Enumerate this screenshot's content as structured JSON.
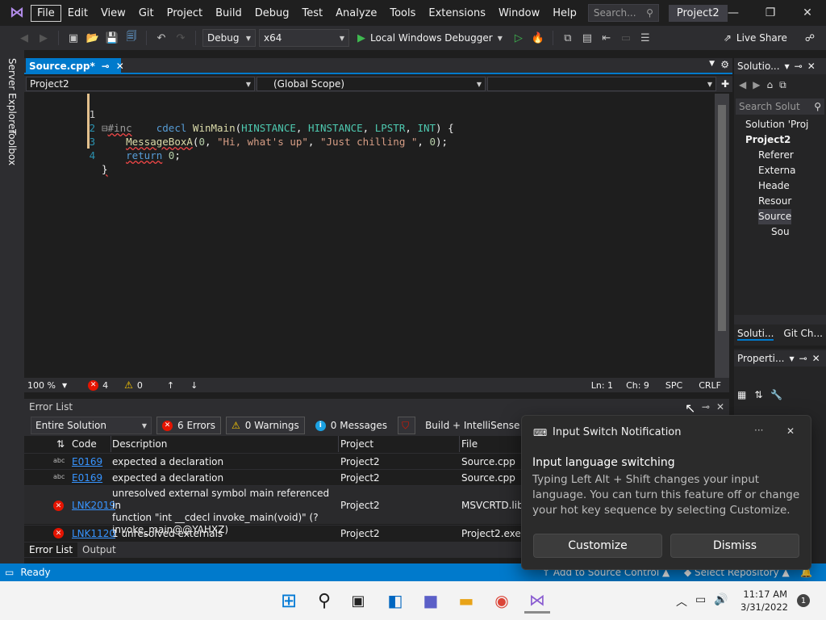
{
  "menubar": {
    "items": [
      "File",
      "Edit",
      "View",
      "Git",
      "Project",
      "Build",
      "Debug",
      "Test",
      "Analyze",
      "Tools",
      "Extensions",
      "Window",
      "Help"
    ],
    "search_placeholder": "Search...",
    "project_badge": "Project2"
  },
  "toolbar": {
    "config": "Debug",
    "platform": "x64",
    "debugger": "Local Windows Debugger",
    "live_share": "Live Share"
  },
  "sidestrip": {
    "server_explorer": "Server Explorer",
    "toolbox": "Toolbox"
  },
  "document": {
    "tab_label": "Source.cpp*",
    "nav_project": "Project2",
    "nav_scope": "(Global Scope)"
  },
  "editor": {
    "line_numbers": [
      "1",
      "2",
      "3",
      "4"
    ]
  },
  "editor_status": {
    "zoom": "100 %",
    "errors": "4",
    "warnings": "0",
    "ln": "Ln: 1",
    "ch": "Ch: 9",
    "spc": "SPC",
    "crlf": "CRLF"
  },
  "error_list": {
    "title": "Error List",
    "scope": "Entire Solution",
    "errors_btn": "6 Errors",
    "warnings_btn": "0 Warnings",
    "messages_btn": "0 Messages",
    "build_filter": "Build + IntelliSense",
    "headers": {
      "code": "Code",
      "description": "Description",
      "project": "Project",
      "file": "File"
    },
    "rows": [
      {
        "code": "E0169",
        "description": "expected a declaration",
        "project": "Project2",
        "file": "Source.cpp"
      },
      {
        "code": "E0169",
        "description": "expected a declaration",
        "project": "Project2",
        "file": "Source.cpp"
      },
      {
        "code": "LNK2019",
        "description_lines": [
          "unresolved external symbol main referenced in",
          "function \"int __cdecl invoke_main(void)\" (?",
          "invoke_main@@YAHXZ)"
        ],
        "project": "Project2",
        "file": "MSVCRTD.lib("
      },
      {
        "code": "LNK1120",
        "description": "1 unresolved externals",
        "project": "Project2",
        "file": "Project2.exe"
      }
    ]
  },
  "bottom_tabs": [
    "Error List",
    "Output"
  ],
  "statusbar": {
    "ready": "Ready",
    "source_control": "Add to Source Control",
    "repo": "Select Repository"
  },
  "solution_explorer": {
    "title": "Solutio...",
    "search_placeholder": "Search Solut",
    "tree": [
      "Solution 'Proj",
      "Project2",
      "Referer",
      "Externa",
      "Heade",
      "Resour",
      "Source",
      "Sou"
    ],
    "tabs": [
      "Soluti...",
      "Git Ch..."
    ]
  },
  "properties": {
    "title": "Properti..."
  },
  "toast": {
    "app": "Input Switch Notification",
    "heading": "Input language switching",
    "body": "Typing Left Alt + Shift changes your input language. You can turn this feature off or change your hot key sequence by selecting Customize.",
    "customize": "Customize",
    "dismiss": "Dismiss"
  },
  "taskbar": {
    "time": "11:17 AM",
    "date": "3/31/2022",
    "badge": "1"
  }
}
